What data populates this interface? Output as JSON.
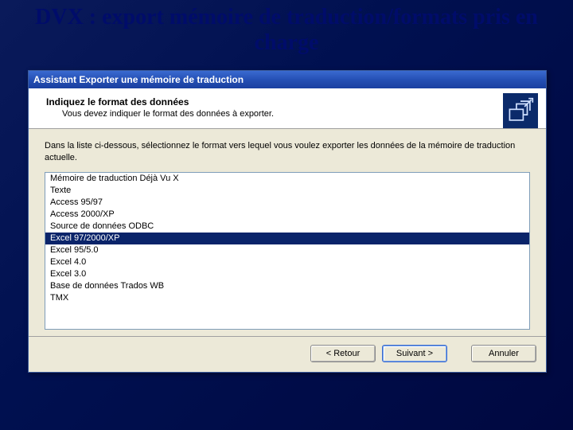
{
  "slide": {
    "title": "DVX : export mémoire de traduction/formats pris en charge"
  },
  "dialog": {
    "title": "Assistant Exporter une mémoire de traduction",
    "header": {
      "title": "Indiquez le format des données",
      "subtitle": "Vous devez indiquer le format des données à exporter."
    },
    "body": {
      "instruction": "Dans la liste ci-dessous, sélectionnez le format vers lequel vous voulez exporter les données de la mémoire de traduction actuelle."
    },
    "list": {
      "items": [
        "Mémoire de traduction Déjà Vu X",
        "Texte",
        "Access 95/97",
        "Access 2000/XP",
        "Source de données ODBC",
        "Excel 97/2000/XP",
        "Excel 95/5.0",
        "Excel 4.0",
        "Excel 3.0",
        "Base de données Trados WB",
        "TMX"
      ],
      "selected_index": 5
    },
    "buttons": {
      "back": "< Retour",
      "next": "Suivant >",
      "cancel": "Annuler"
    }
  },
  "icons": {
    "wizard": "export-tm-icon"
  }
}
